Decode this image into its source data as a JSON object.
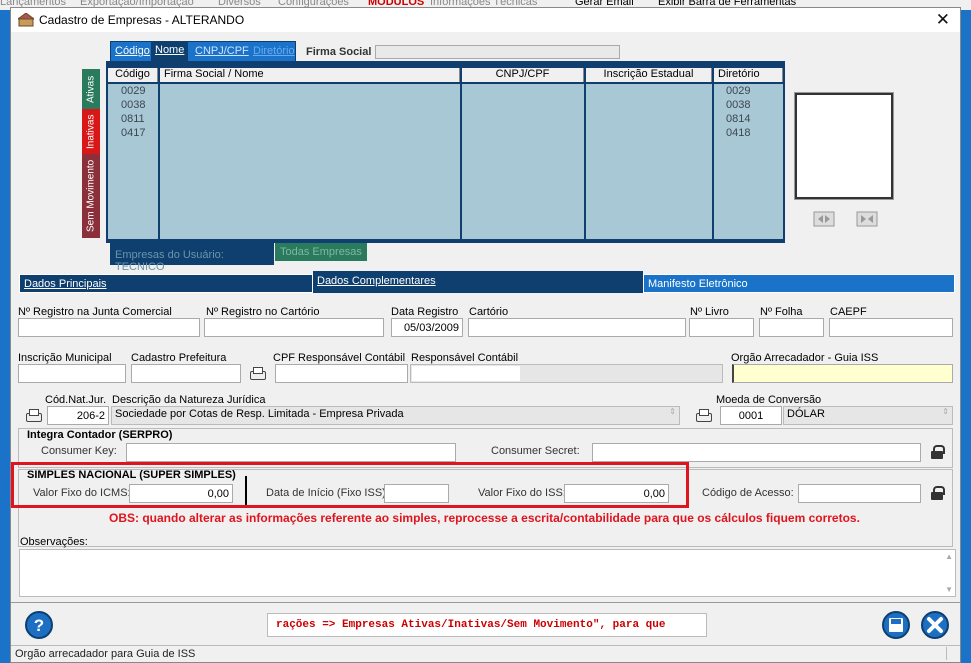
{
  "background_menu": [
    "Lançamentos",
    "Exportação/Importação",
    "Diversos",
    "Configurações",
    "MÓDULOS",
    "Informações Técnicas",
    "Gerar Email",
    "Exibir Barra de Ferramentas"
  ],
  "dialog": {
    "title": "Cadastro de Empresas  -  ALTERANDO",
    "close_glyph": "✕"
  },
  "search": {
    "tabs": [
      "Código",
      "Nome",
      "CNPJ/CPF",
      "Diretório"
    ],
    "label": "Firma Social",
    "value": ""
  },
  "side_tabs": [
    "Ativas",
    "Inativas",
    "Sem Movimento"
  ],
  "grid": {
    "headers": [
      "Código",
      "Firma Social / Nome",
      "CNPJ/CPF",
      "Inscrição Estadual",
      "Diretório"
    ],
    "codes": [
      "0029",
      "0038",
      "0811",
      "0417"
    ],
    "dirs": [
      "0029",
      "0038",
      "0814",
      "0418"
    ]
  },
  "bottom_tabs": [
    "Empresas do Usuário: TECNICO",
    "Todas Empresas"
  ],
  "sections": [
    "Dados Principais",
    "Dados Complementares",
    "Manifesto Eletrônico"
  ],
  "form": {
    "registro_junta": "Nº Registro na Junta Comercial",
    "registro_cartorio": "Nº Registro no Cartório",
    "data_registro": "Data Registro",
    "data_registro_value": "05/03/2009",
    "cartorio": "Cartório",
    "n_livro": "Nº Livro",
    "n_folha": "Nº Folha",
    "caepf": "CAEPF",
    "inscricao_municipal": "Inscrição Municipal",
    "cadastro_prefeitura": "Cadastro Prefeitura",
    "cpf_responsavel": "CPF Responsável Contábil",
    "responsavel_contabil": "Responsável Contábil",
    "orgao_arrecadador": "Orgão Arrecadador - Guia ISS",
    "cod_nat_jur": "Cód.Nat.Jur.",
    "cod_nat_jur_value": "206-2",
    "desc_nat_jur": "Descrição da Natureza Jurídica",
    "desc_nat_jur_value": "Sociedade por Cotas de Resp. Limitada - Empresa Privada",
    "moeda_conversao": "Moeda de Conversão",
    "moeda_code": "0001",
    "moeda_name": "DÓLAR"
  },
  "serpro": {
    "title": "Integra Contador (SERPRO)",
    "consumer_key": "Consumer Key:",
    "consumer_secret": "Consumer Secret:"
  },
  "simples": {
    "title": "SIMPLES NACIONAL (SUPER SIMPLES)",
    "icms_label": "Valor Fixo do ICMS:",
    "icms_value": "0,00",
    "data_inicio_label": "Data de Início (Fixo ISS):",
    "iss_label": "Valor Fixo do ISS:",
    "iss_value": "0,00",
    "codigo_acesso": "Código de Acesso:"
  },
  "obs_warning": "OBS: quando alterar as informações referente ao simples, reprocesse a escrita/contabilidade para que os cálculos fiquem corretos.",
  "observacoes_label": "Observações:",
  "marquee": "rações => Empresas Ativas/Inativas/Sem Movimento\", para que",
  "status_bar": "Orgão arrecadador para Guia de ISS",
  "colors": {
    "highlight_red": "#e0141e",
    "nav_blue": "#0e3f6e",
    "tab_blue": "#1a73c8"
  }
}
